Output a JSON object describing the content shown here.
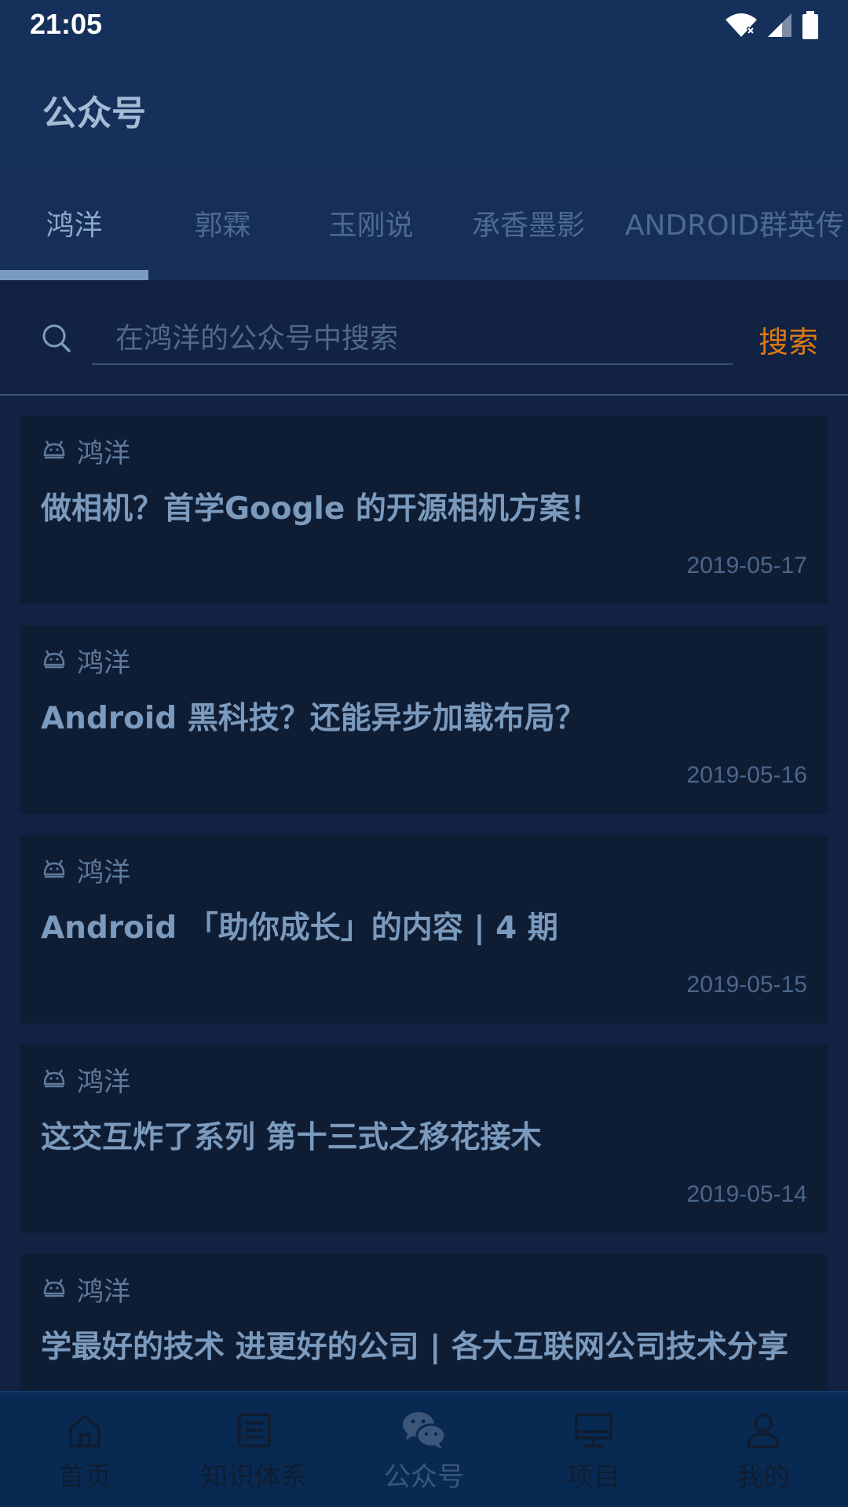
{
  "status_bar": {
    "time": "21:05"
  },
  "app_bar": {
    "title": "公众号"
  },
  "tabs": [
    {
      "label": "鸿洋",
      "active": true
    },
    {
      "label": "郭霖",
      "active": false
    },
    {
      "label": "玉刚说",
      "active": false
    },
    {
      "label": "承香墨影",
      "active": false
    },
    {
      "label": "ANDROID群英传",
      "active": false
    }
  ],
  "search": {
    "placeholder": "在鸿洋的公众号中搜索",
    "button_label": "搜索"
  },
  "articles": [
    {
      "author": "鸿洋",
      "title": "做相机？首学Google 的开源相机方案！",
      "date": "2019-05-17"
    },
    {
      "author": "鸿洋",
      "title": "Android 黑科技？还能异步加载布局？",
      "date": "2019-05-16"
    },
    {
      "author": "鸿洋",
      "title": "Android 「助你成长」的内容 | 4 期",
      "date": "2019-05-15"
    },
    {
      "author": "鸿洋",
      "title": "这交互炸了系列 第十三式之移花接木",
      "date": "2019-05-14"
    },
    {
      "author": "鸿洋",
      "title": "学最好的技术 进更好的公司 | 各大互联网公司技术分享",
      "date": ""
    }
  ],
  "bottom_nav": [
    {
      "label": "首页",
      "icon": "home-icon",
      "active": false
    },
    {
      "label": "知识体系",
      "icon": "list-icon",
      "active": false
    },
    {
      "label": "公众号",
      "icon": "wechat-icon",
      "active": true
    },
    {
      "label": "项目",
      "icon": "monitor-icon",
      "active": false
    },
    {
      "label": "我的",
      "icon": "person-icon",
      "active": false
    }
  ],
  "colors": {
    "accent": "#d97a14",
    "header": "#15305a",
    "card": "#0f1d34",
    "nav": "#082a52"
  }
}
